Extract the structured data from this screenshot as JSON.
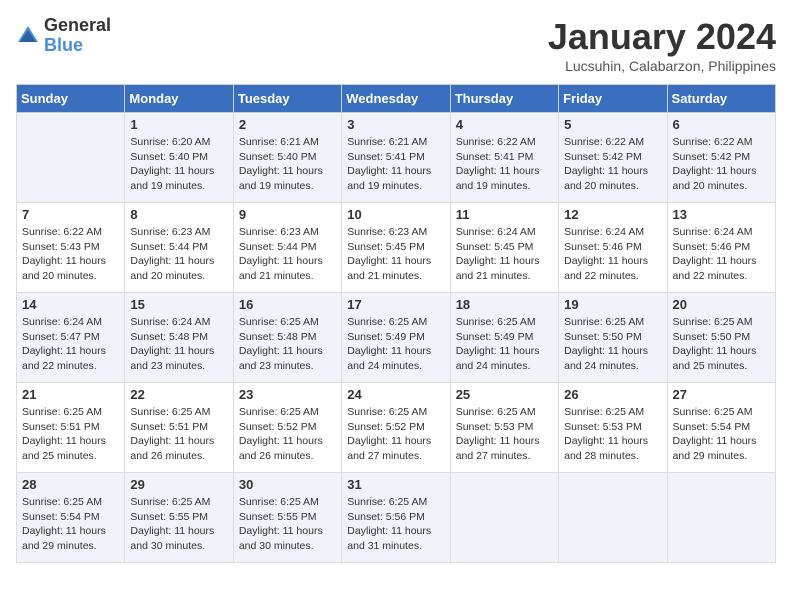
{
  "header": {
    "logo_general": "General",
    "logo_blue": "Blue",
    "month_title": "January 2024",
    "location": "Lucsuhin, Calabarzon, Philippines"
  },
  "days_of_week": [
    "Sunday",
    "Monday",
    "Tuesday",
    "Wednesday",
    "Thursday",
    "Friday",
    "Saturday"
  ],
  "weeks": [
    [
      {
        "day": "",
        "info": ""
      },
      {
        "day": "1",
        "info": "Sunrise: 6:20 AM\nSunset: 5:40 PM\nDaylight: 11 hours and 19 minutes."
      },
      {
        "day": "2",
        "info": "Sunrise: 6:21 AM\nSunset: 5:40 PM\nDaylight: 11 hours and 19 minutes."
      },
      {
        "day": "3",
        "info": "Sunrise: 6:21 AM\nSunset: 5:41 PM\nDaylight: 11 hours and 19 minutes."
      },
      {
        "day": "4",
        "info": "Sunrise: 6:22 AM\nSunset: 5:41 PM\nDaylight: 11 hours and 19 minutes."
      },
      {
        "day": "5",
        "info": "Sunrise: 6:22 AM\nSunset: 5:42 PM\nDaylight: 11 hours and 20 minutes."
      },
      {
        "day": "6",
        "info": "Sunrise: 6:22 AM\nSunset: 5:42 PM\nDaylight: 11 hours and 20 minutes."
      }
    ],
    [
      {
        "day": "7",
        "info": "Sunrise: 6:22 AM\nSunset: 5:43 PM\nDaylight: 11 hours and 20 minutes."
      },
      {
        "day": "8",
        "info": "Sunrise: 6:23 AM\nSunset: 5:44 PM\nDaylight: 11 hours and 20 minutes."
      },
      {
        "day": "9",
        "info": "Sunrise: 6:23 AM\nSunset: 5:44 PM\nDaylight: 11 hours and 21 minutes."
      },
      {
        "day": "10",
        "info": "Sunrise: 6:23 AM\nSunset: 5:45 PM\nDaylight: 11 hours and 21 minutes."
      },
      {
        "day": "11",
        "info": "Sunrise: 6:24 AM\nSunset: 5:45 PM\nDaylight: 11 hours and 21 minutes."
      },
      {
        "day": "12",
        "info": "Sunrise: 6:24 AM\nSunset: 5:46 PM\nDaylight: 11 hours and 22 minutes."
      },
      {
        "day": "13",
        "info": "Sunrise: 6:24 AM\nSunset: 5:46 PM\nDaylight: 11 hours and 22 minutes."
      }
    ],
    [
      {
        "day": "14",
        "info": "Sunrise: 6:24 AM\nSunset: 5:47 PM\nDaylight: 11 hours and 22 minutes."
      },
      {
        "day": "15",
        "info": "Sunrise: 6:24 AM\nSunset: 5:48 PM\nDaylight: 11 hours and 23 minutes."
      },
      {
        "day": "16",
        "info": "Sunrise: 6:25 AM\nSunset: 5:48 PM\nDaylight: 11 hours and 23 minutes."
      },
      {
        "day": "17",
        "info": "Sunrise: 6:25 AM\nSunset: 5:49 PM\nDaylight: 11 hours and 24 minutes."
      },
      {
        "day": "18",
        "info": "Sunrise: 6:25 AM\nSunset: 5:49 PM\nDaylight: 11 hours and 24 minutes."
      },
      {
        "day": "19",
        "info": "Sunrise: 6:25 AM\nSunset: 5:50 PM\nDaylight: 11 hours and 24 minutes."
      },
      {
        "day": "20",
        "info": "Sunrise: 6:25 AM\nSunset: 5:50 PM\nDaylight: 11 hours and 25 minutes."
      }
    ],
    [
      {
        "day": "21",
        "info": "Sunrise: 6:25 AM\nSunset: 5:51 PM\nDaylight: 11 hours and 25 minutes."
      },
      {
        "day": "22",
        "info": "Sunrise: 6:25 AM\nSunset: 5:51 PM\nDaylight: 11 hours and 26 minutes."
      },
      {
        "day": "23",
        "info": "Sunrise: 6:25 AM\nSunset: 5:52 PM\nDaylight: 11 hours and 26 minutes."
      },
      {
        "day": "24",
        "info": "Sunrise: 6:25 AM\nSunset: 5:52 PM\nDaylight: 11 hours and 27 minutes."
      },
      {
        "day": "25",
        "info": "Sunrise: 6:25 AM\nSunset: 5:53 PM\nDaylight: 11 hours and 27 minutes."
      },
      {
        "day": "26",
        "info": "Sunrise: 6:25 AM\nSunset: 5:53 PM\nDaylight: 11 hours and 28 minutes."
      },
      {
        "day": "27",
        "info": "Sunrise: 6:25 AM\nSunset: 5:54 PM\nDaylight: 11 hours and 29 minutes."
      }
    ],
    [
      {
        "day": "28",
        "info": "Sunrise: 6:25 AM\nSunset: 5:54 PM\nDaylight: 11 hours and 29 minutes."
      },
      {
        "day": "29",
        "info": "Sunrise: 6:25 AM\nSunset: 5:55 PM\nDaylight: 11 hours and 30 minutes."
      },
      {
        "day": "30",
        "info": "Sunrise: 6:25 AM\nSunset: 5:55 PM\nDaylight: 11 hours and 30 minutes."
      },
      {
        "day": "31",
        "info": "Sunrise: 6:25 AM\nSunset: 5:56 PM\nDaylight: 11 hours and 31 minutes."
      },
      {
        "day": "",
        "info": ""
      },
      {
        "day": "",
        "info": ""
      },
      {
        "day": "",
        "info": ""
      }
    ]
  ]
}
